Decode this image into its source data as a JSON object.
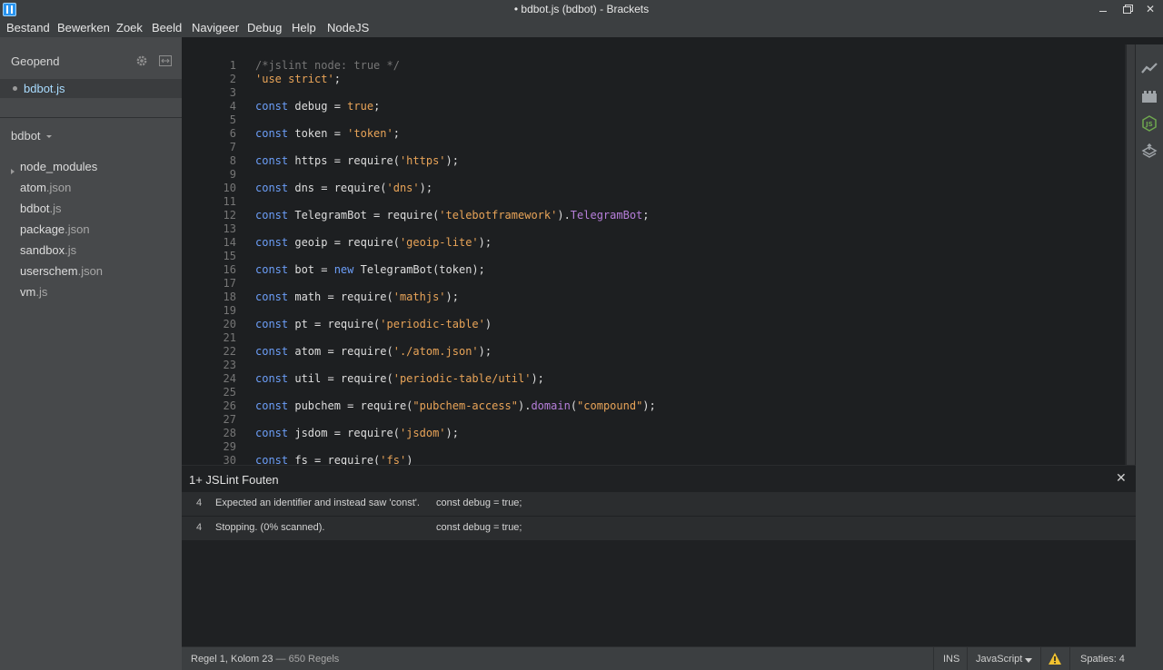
{
  "window": {
    "title": "• bdbot.js (bdbot) - Brackets"
  },
  "menu": [
    "Bestand",
    "Bewerken",
    "Zoek",
    "Beeld",
    "Navigeer",
    "Debug",
    "Help",
    "NodeJS"
  ],
  "sidebar": {
    "working_files_title": "Geopend",
    "working_file": "bdbot.js",
    "project_name": "bdbot",
    "tree": [
      {
        "name": "node_modules",
        "ext": "",
        "folder": true
      },
      {
        "name": "atom",
        "ext": ".json"
      },
      {
        "name": "bdbot",
        "ext": ".js"
      },
      {
        "name": "package",
        "ext": ".json"
      },
      {
        "name": "sandbox",
        "ext": ".js"
      },
      {
        "name": "userschem",
        "ext": ".json"
      },
      {
        "name": "vm",
        "ext": ".js"
      }
    ]
  },
  "editor": {
    "lines": [
      {
        "n": "1",
        "t": [
          [
            "/*jslint node: true */",
            "comment"
          ]
        ]
      },
      {
        "n": "2",
        "t": [
          [
            "'use strict'",
            "string"
          ],
          [
            ";",
            ""
          ]
        ]
      },
      {
        "n": "3",
        "t": []
      },
      {
        "n": "4",
        "t": [
          [
            "const",
            "keyword"
          ],
          [
            " debug = ",
            ""
          ],
          [
            "true",
            "atom"
          ],
          [
            ";",
            ""
          ]
        ]
      },
      {
        "n": "5",
        "t": []
      },
      {
        "n": "6",
        "t": [
          [
            "const",
            "keyword"
          ],
          [
            " token = ",
            ""
          ],
          [
            "'token'",
            "string"
          ],
          [
            ";",
            ""
          ]
        ]
      },
      {
        "n": "7",
        "t": []
      },
      {
        "n": "8",
        "t": [
          [
            "const",
            "keyword"
          ],
          [
            " https = require(",
            ""
          ],
          [
            "'https'",
            "string"
          ],
          [
            ");",
            ""
          ]
        ]
      },
      {
        "n": "9",
        "t": []
      },
      {
        "n": "10",
        "t": [
          [
            "const",
            "keyword"
          ],
          [
            " dns = require(",
            ""
          ],
          [
            "'dns'",
            "string"
          ],
          [
            ");",
            ""
          ]
        ]
      },
      {
        "n": "11",
        "t": []
      },
      {
        "n": "12",
        "t": [
          [
            "const",
            "keyword"
          ],
          [
            " TelegramBot = require(",
            ""
          ],
          [
            "'telebotframework'",
            "string"
          ],
          [
            ").",
            ""
          ],
          [
            "TelegramBot",
            "prop"
          ],
          [
            ";",
            ""
          ]
        ]
      },
      {
        "n": "13",
        "t": []
      },
      {
        "n": "14",
        "t": [
          [
            "const",
            "keyword"
          ],
          [
            " geoip = require(",
            ""
          ],
          [
            "'geoip-lite'",
            "string"
          ],
          [
            ");",
            ""
          ]
        ]
      },
      {
        "n": "15",
        "t": []
      },
      {
        "n": "16",
        "t": [
          [
            "const",
            "keyword"
          ],
          [
            " bot = ",
            ""
          ],
          [
            "new",
            "keyword"
          ],
          [
            " TelegramBot(token);",
            ""
          ]
        ]
      },
      {
        "n": "17",
        "t": []
      },
      {
        "n": "18",
        "t": [
          [
            "const",
            "keyword"
          ],
          [
            " math = require(",
            ""
          ],
          [
            "'mathjs'",
            "string"
          ],
          [
            ");",
            ""
          ]
        ]
      },
      {
        "n": "19",
        "t": []
      },
      {
        "n": "20",
        "t": [
          [
            "const",
            "keyword"
          ],
          [
            " pt = require(",
            ""
          ],
          [
            "'periodic-table'",
            "string"
          ],
          [
            ")",
            ""
          ]
        ]
      },
      {
        "n": "21",
        "t": []
      },
      {
        "n": "22",
        "t": [
          [
            "const",
            "keyword"
          ],
          [
            " atom = require(",
            ""
          ],
          [
            "'./atom.json'",
            "string"
          ],
          [
            ");",
            ""
          ]
        ]
      },
      {
        "n": "23",
        "t": []
      },
      {
        "n": "24",
        "t": [
          [
            "const",
            "keyword"
          ],
          [
            " util = require(",
            ""
          ],
          [
            "'periodic-table/util'",
            "string"
          ],
          [
            ");",
            ""
          ]
        ]
      },
      {
        "n": "25",
        "t": []
      },
      {
        "n": "26",
        "t": [
          [
            "const",
            "keyword"
          ],
          [
            " pubchem = require(",
            ""
          ],
          [
            "\"pubchem-access\"",
            "string"
          ],
          [
            ").",
            ""
          ],
          [
            "domain",
            "prop"
          ],
          [
            "(",
            ""
          ],
          [
            "\"compound\"",
            "string"
          ],
          [
            ");",
            ""
          ]
        ]
      },
      {
        "n": "27",
        "t": []
      },
      {
        "n": "28",
        "t": [
          [
            "const",
            "keyword"
          ],
          [
            " jsdom = require(",
            ""
          ],
          [
            "'jsdom'",
            "string"
          ],
          [
            ");",
            ""
          ]
        ]
      },
      {
        "n": "29",
        "t": []
      },
      {
        "n": "30",
        "t": [
          [
            "const",
            "keyword"
          ],
          [
            " fs = require(",
            ""
          ],
          [
            "'fs'",
            "string"
          ],
          [
            ")",
            ""
          ]
        ]
      }
    ]
  },
  "lint": {
    "title": "1+ JSLint Fouten",
    "rows": [
      {
        "line": "4",
        "message": "Expected an identifier and instead saw 'const'.",
        "code": "const debug = true;"
      },
      {
        "line": "4",
        "message": "Stopping. (0% scanned).",
        "code": "const debug = true;"
      }
    ]
  },
  "status": {
    "cursor": "Regel 1, Kolom 23",
    "lines": " — 650 Regels",
    "mode": "INS",
    "language": "JavaScript",
    "indent": "Spaties: 4"
  },
  "right_toolbar": [
    "live-preview-icon",
    "extension-manager-icon",
    "nodejs-icon",
    "layers-icon"
  ]
}
